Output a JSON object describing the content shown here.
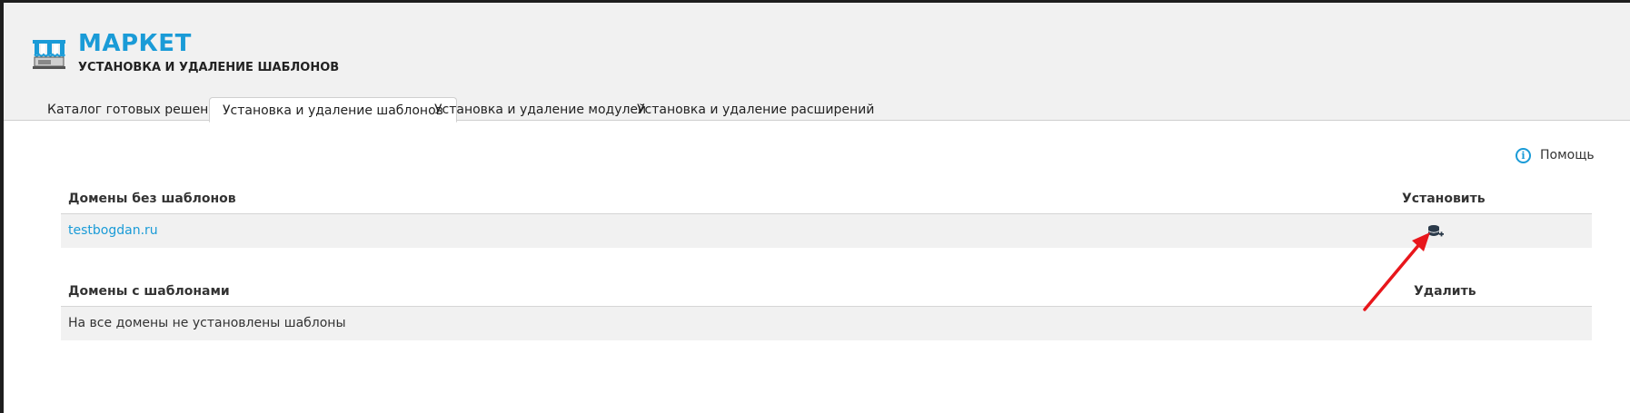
{
  "header": {
    "title": "МАРКЕТ",
    "subtitle": "УСТАНОВКА И УДАЛЕНИЕ ШАБЛОНОВ",
    "icon": "market-store-icon"
  },
  "tabs": [
    {
      "label": "Каталог готовых решений",
      "active": false
    },
    {
      "label": "Установка и удаление шаблонов",
      "active": true
    },
    {
      "label": "Установка и удаление модулей",
      "active": false
    },
    {
      "label": "Установка и удаление расширений",
      "active": false
    }
  ],
  "help": {
    "label": "Помощь",
    "icon": "info-icon"
  },
  "domains_without_templates": {
    "header": "Домены без шаблонов",
    "action_header": "Установить",
    "rows": [
      {
        "domain": "testbogdan.ru",
        "action_icon": "database-add-icon"
      }
    ]
  },
  "domains_with_templates": {
    "header": "Домены с шаблонами",
    "action_header": "Удалить",
    "empty_message": "На все домены не установлены шаблоны"
  },
  "colors": {
    "accent": "#1a9bd7",
    "header_bg": "#f1f1f1",
    "row_bg": "#f1f1f1",
    "annotation_arrow": "#e8161b"
  }
}
